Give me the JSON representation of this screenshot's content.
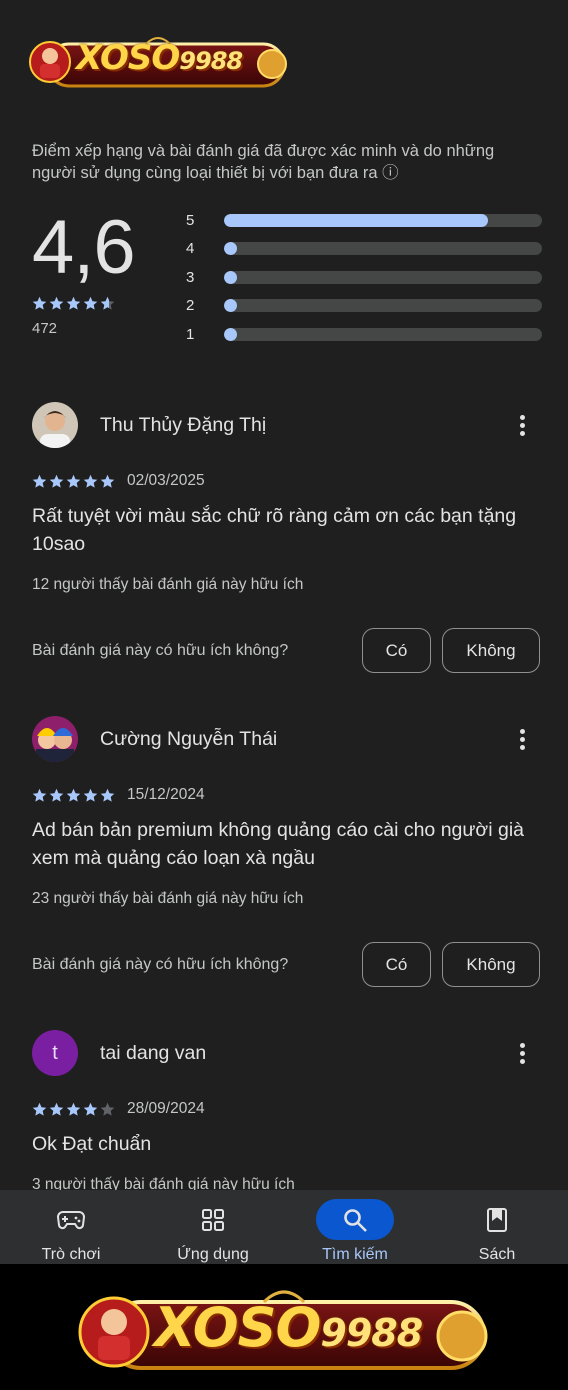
{
  "brand": {
    "logo_main": "XOSO",
    "logo_num": "9988"
  },
  "summary": {
    "verified_text": "Điểm xếp hạng và bài đánh giá đã được xác minh và do những người sử dụng cùng loại thiết bị với bạn đưa ra",
    "info_icon": "ⓘ",
    "average": "4,6",
    "average_stars": 4.6,
    "count": "472",
    "distribution": [
      {
        "label": "5",
        "fraction": 0.83
      },
      {
        "label": "4",
        "fraction": 0.04
      },
      {
        "label": "3",
        "fraction": 0.03
      },
      {
        "label": "2",
        "fraction": 0.03
      },
      {
        "label": "1",
        "fraction": 0.03
      }
    ]
  },
  "reviews": [
    {
      "name": "Thu Thủy Đặng Thị",
      "stars": 5,
      "date": "02/03/2025",
      "text": "Rất tuyệt vời màu sắc chữ rõ ràng cảm ơn các bạn tặng 10sao",
      "helpful_count": "12 người thấy bài đánh giá này hữu ích",
      "helpful_question": "Bài đánh giá này có hữu ích không?",
      "yes_label": "Có",
      "no_label": "Không"
    },
    {
      "name": "Cường Nguyễn Thái",
      "stars": 5,
      "date": "15/12/2024",
      "text": "Ad bán bản premium không quảng cáo cài cho người già xem mà quảng cáo loạn xà ngầu",
      "helpful_count": "23 người thấy bài đánh giá này hữu ích",
      "helpful_question": "Bài đánh giá này có hữu ích không?",
      "yes_label": "Có",
      "no_label": "Không"
    },
    {
      "name": "tai dang van",
      "avatar_letter": "t",
      "stars": 4,
      "date": "28/09/2024",
      "text": "Ok Đạt chuẩn",
      "helpful_count": "3 người thấy bài đánh giá này hữu ích"
    }
  ],
  "nav": [
    {
      "label": "Trò chơi",
      "icon": "gamepad-icon",
      "active": false
    },
    {
      "label": "Ứng dụng",
      "icon": "apps-grid-icon",
      "active": false
    },
    {
      "label": "Tìm kiếm",
      "icon": "search-icon",
      "active": true
    },
    {
      "label": "Sách",
      "icon": "bookmark-icon",
      "active": false
    }
  ],
  "colors": {
    "background": "#1f1f1f",
    "accent": "#a8c7fa",
    "nav_active": "#0b57d0",
    "star_empty": "#5f6368"
  }
}
